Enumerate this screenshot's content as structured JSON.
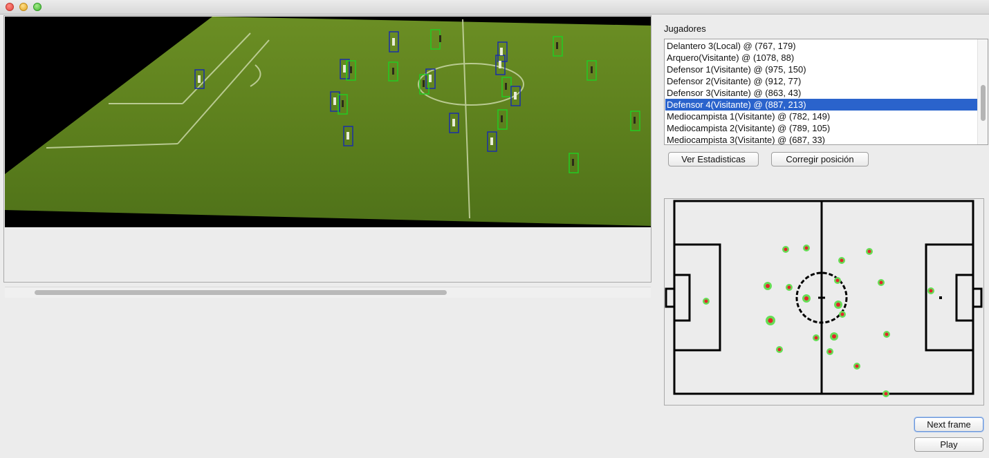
{
  "window": {
    "buttons": [
      "close",
      "minimize",
      "zoom"
    ]
  },
  "players": {
    "label": "Jugadores",
    "selected_index": 5,
    "items": [
      "Delantero 3(Local) @ (767, 179)",
      "Arquero(Visitante) @ (1078, 88)",
      "Defensor 1(Visitante) @ (975, 150)",
      "Defensor 2(Visitante) @ (912, 77)",
      "Defensor 3(Visitante) @ (863, 43)",
      "Defensor 4(Visitante) @ (887, 213)",
      "Mediocampista 1(Visitante) @ (782, 149)",
      "Mediocampista 2(Visitante) @ (789, 105)",
      "Mediocampista 3(Visitante) @ (687, 33)"
    ]
  },
  "actions": {
    "stats": "Ver Estadisticas",
    "correct": "Corregir posición",
    "next": "Next frame",
    "play": "Play"
  },
  "colors": {
    "selection": "#2a63cc",
    "pitch": "#5f7f1e",
    "box_local": "#1a2fa8",
    "box_visitor": "#22cc22"
  },
  "icons": {
    "close": "close-icon",
    "minimize": "minimize-icon",
    "zoom": "zoom-icon"
  }
}
